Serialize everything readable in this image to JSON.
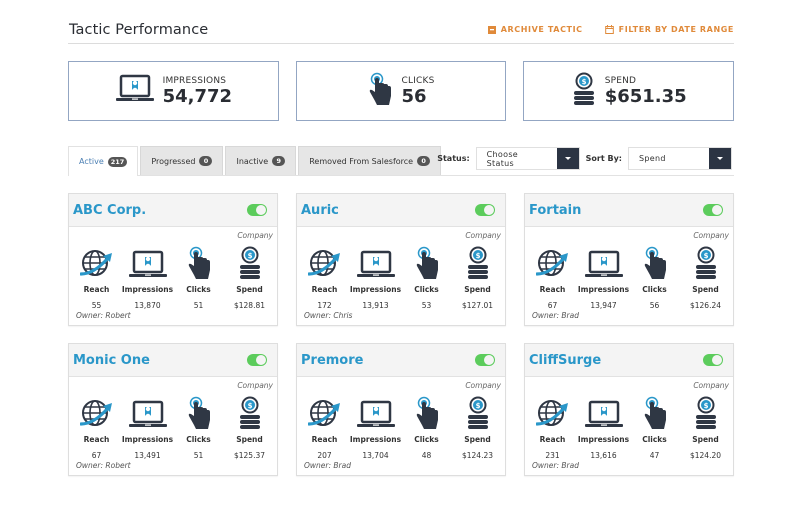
{
  "header": {
    "title": "Tactic Performance",
    "archive_label": "ARCHIVE TACTIC",
    "filter_label": "FILTER BY DATE RANGE"
  },
  "stats": [
    {
      "icon": "laptop-user-icon",
      "label": "IMPRESSIONS",
      "value": "54,772"
    },
    {
      "icon": "pointer-hand-icon",
      "label": "CLICKS",
      "value": "56"
    },
    {
      "icon": "coin-stack-icon",
      "label": "SPEND",
      "value": "$651.35"
    }
  ],
  "tabs": [
    {
      "label": "Active",
      "count": "217",
      "active": true
    },
    {
      "label": "Progressed",
      "count": "0",
      "active": false
    },
    {
      "label": "Inactive",
      "count": "9",
      "active": false
    },
    {
      "label": "Removed From Salesforce",
      "count": "0",
      "active": false
    }
  ],
  "filters": {
    "status_label": "Status:",
    "status_value": "Choose Status",
    "sort_label": "Sort By:",
    "sort_value": "Spend"
  },
  "metric_labels": {
    "reach": "Reach",
    "impressions": "Impressions",
    "clicks": "Clicks",
    "spend": "Spend"
  },
  "colors": {
    "accent": "#2a97c9",
    "action": "#e08a3a",
    "toggle_on": "#5ccc5c",
    "dark": "#2b3443"
  },
  "cards": [
    {
      "name": "ABC Corp.",
      "type": "Company",
      "enabled": true,
      "reach": "55",
      "impressions": "13,870",
      "clicks": "51",
      "spend": "$128.81",
      "owner": "Owner: Robert"
    },
    {
      "name": "Auric",
      "type": "Company",
      "enabled": true,
      "reach": "172",
      "impressions": "13,913",
      "clicks": "53",
      "spend": "$127.01",
      "owner": "Owner: Chris"
    },
    {
      "name": "Fortain",
      "type": "Company",
      "enabled": true,
      "reach": "67",
      "impressions": "13,947",
      "clicks": "56",
      "spend": "$126.24",
      "owner": "Owner: Brad"
    },
    {
      "name": "Monic One",
      "type": "Company",
      "enabled": true,
      "reach": "67",
      "impressions": "13,491",
      "clicks": "51",
      "spend": "$125.37",
      "owner": "Owner: Robert"
    },
    {
      "name": "Premore",
      "type": "Company",
      "enabled": true,
      "reach": "207",
      "impressions": "13,704",
      "clicks": "48",
      "spend": "$124.23",
      "owner": "Owner: Brad"
    },
    {
      "name": "CliffSurge",
      "type": "Company",
      "enabled": true,
      "reach": "231",
      "impressions": "13,616",
      "clicks": "47",
      "spend": "$124.20",
      "owner": "Owner: Brad"
    }
  ]
}
